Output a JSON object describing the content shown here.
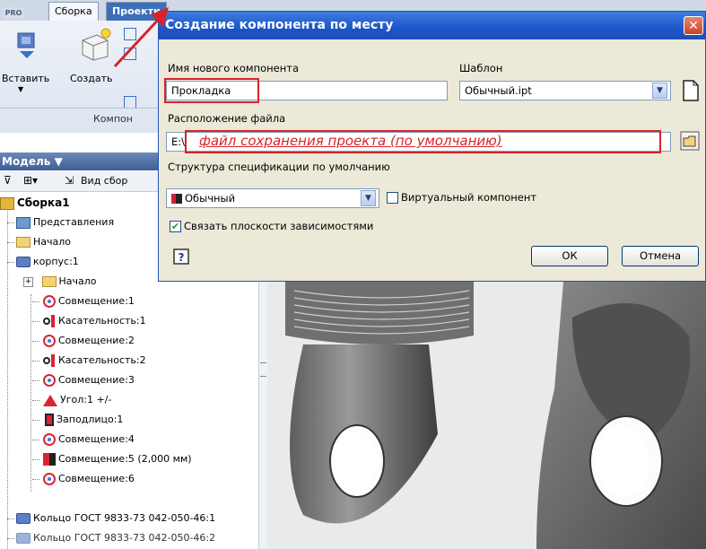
{
  "ribbon": {
    "pro_badge": "PRO",
    "tabs": [
      "Сборка",
      "Проекти"
    ],
    "insert_label": "Вставить",
    "create_label": "Создать",
    "panel_title": "Компон"
  },
  "browser": {
    "title": "Модель ▼",
    "view_label": "Вид сбор",
    "tree": [
      {
        "label": "Сборка1",
        "icon": "assembly-icon"
      },
      {
        "label": "Представления",
        "icon": "representations-icon"
      },
      {
        "label": "Начало",
        "icon": "folder-icon"
      },
      {
        "label": "корпус:1",
        "icon": "part-icon"
      },
      {
        "label": "Начало",
        "icon": "folder-icon"
      },
      {
        "label": "Совмещение:1",
        "icon": "mate-icon"
      },
      {
        "label": "Касательность:1",
        "icon": "tangent-icon"
      },
      {
        "label": "Совмещение:2",
        "icon": "mate-icon"
      },
      {
        "label": "Касательность:2",
        "icon": "tangent-icon"
      },
      {
        "label": "Совмещение:3",
        "icon": "mate-icon"
      },
      {
        "label": "Угол:1 +/-",
        "icon": "angle-icon"
      },
      {
        "label": "Заподлицо:1",
        "icon": "flush-icon"
      },
      {
        "label": "Совмещение:4",
        "icon": "mate-icon"
      },
      {
        "label": "Совмещение:5 (2,000 мм)",
        "icon": "mate-offset-icon"
      },
      {
        "label": "Совмещение:6",
        "icon": "mate-icon"
      },
      {
        "label": "Кольцо ГОСТ 9833-73 042-050-46:1",
        "icon": "part-icon"
      },
      {
        "label": "Кольцо ГОСТ 9833-73 042-050-46:2",
        "icon": "part-icon"
      }
    ]
  },
  "dialog": {
    "title": "Создание компонента по месту",
    "close_glyph": "✕",
    "name_label": "Имя нового компонента",
    "name_value": "Прокладка",
    "template_label": "Шаблон",
    "template_value": "Обычный.ipt",
    "location_label": "Расположение файла",
    "location_value": "E:\\",
    "location_annotation": "файл сохранения проекта (по умолчанию)",
    "bom_label": "Структура спецификации по умолчанию",
    "bom_value": "Обычный",
    "virtual_label": "Виртуальный компонент",
    "virtual_checked": false,
    "constrain_label": "Связать плоскости зависимостями",
    "constrain_checked": true,
    "ok_label": "ОК",
    "cancel_label": "Отмена"
  },
  "colors": {
    "title_bar": "#1c55c9",
    "annotation_red": "#d8232a",
    "dialog_bg": "#ece9d8"
  }
}
